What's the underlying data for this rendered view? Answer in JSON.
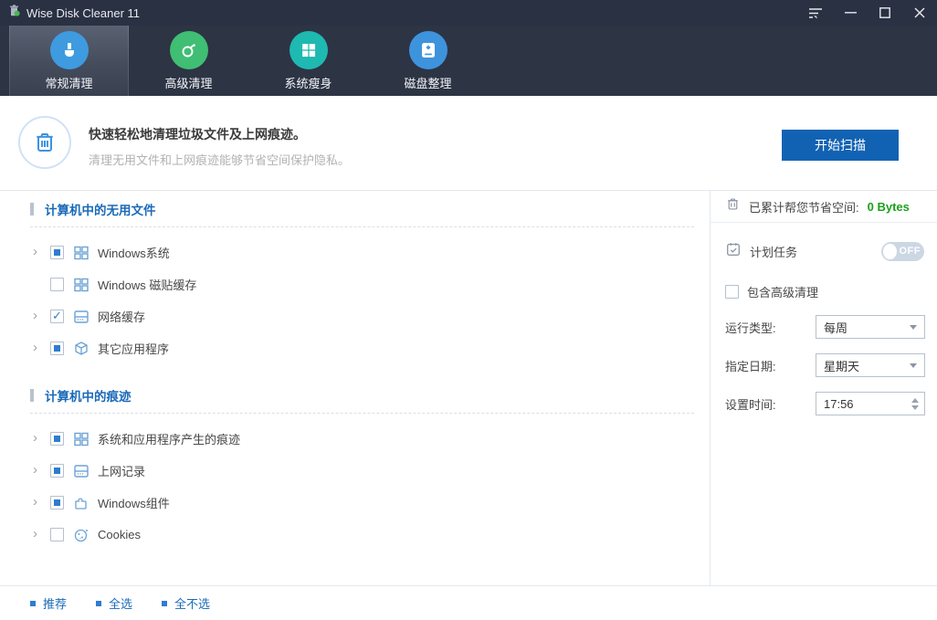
{
  "window": {
    "title": "Wise Disk Cleaner 11",
    "app_icon": "trash-app-icon",
    "controls": [
      {
        "name": "menu-icon"
      },
      {
        "name": "minimize-icon"
      },
      {
        "name": "maximize-icon"
      },
      {
        "name": "close-icon"
      }
    ]
  },
  "nav": {
    "tabs": [
      {
        "label": "常规清理",
        "icon": "broom-icon",
        "color": "#3e9be0",
        "active": true
      },
      {
        "label": "高级清理",
        "icon": "deep-scan-icon",
        "color": "#3fbe74",
        "active": false
      },
      {
        "label": "系统瘦身",
        "icon": "windows-logo-icon",
        "color": "#1eb9b1",
        "active": false
      },
      {
        "label": "磁盘整理",
        "icon": "disk-icon",
        "color": "#3e93dd",
        "active": false
      }
    ]
  },
  "header": {
    "icon": "trash-circle-icon",
    "title": "快速轻松地清理垃圾文件及上网痕迹。",
    "subtitle": "清理无用文件和上网痕迹能够节省空间保护隐私。",
    "scan_button": "开始扫描"
  },
  "tree": {
    "sections": [
      {
        "title": "计算机中的无用文件",
        "items": [
          {
            "label": "Windows系统",
            "checkbox": "partial",
            "chevron": "shown",
            "icon": "windows-tiles-icon"
          },
          {
            "label": "Windows 磁贴缓存",
            "checkbox": "unchecked",
            "chevron": "hidden",
            "icon": "windows-tiles-icon"
          },
          {
            "label": "网络缓存",
            "checkbox": "checked",
            "chevron": "shown",
            "icon": "browser-window-icon"
          },
          {
            "label": "其它应用程序",
            "checkbox": "partial",
            "chevron": "shown",
            "icon": "cube-icon"
          }
        ]
      },
      {
        "title": "计算机中的痕迹",
        "items": [
          {
            "label": "系统和应用程序产生的痕迹",
            "checkbox": "partial",
            "chevron": "shown",
            "icon": "windows-tiles-icon"
          },
          {
            "label": "上网记录",
            "checkbox": "partial",
            "chevron": "shown",
            "icon": "browser-window-icon"
          },
          {
            "label": "Windows组件",
            "checkbox": "partial",
            "chevron": "shown",
            "icon": "puzzle-icon"
          },
          {
            "label": "Cookies",
            "checkbox": "unchecked",
            "chevron": "shown",
            "icon": "cookie-icon"
          }
        ]
      }
    ]
  },
  "sidebar": {
    "saved_icon": "trash-icon",
    "saved_label": "已累计帮您节省空间:",
    "saved_value": "0 Bytes",
    "saved_value_color": "#1ba01b",
    "schedule_icon": "calendar-check-icon",
    "schedule_label": "计划任务",
    "schedule_toggle": "OFF",
    "include_advanced_label": "包含高级清理",
    "include_advanced_checked": "unchecked",
    "run_type_label": "运行类型:",
    "run_type_value": "每周",
    "day_label": "指定日期:",
    "day_value": "星期天",
    "time_label": "设置时间:",
    "time_value": "17:56"
  },
  "footer": {
    "links": [
      "推荐",
      "全选",
      "全不选"
    ]
  },
  "colors": {
    "titlebar_bg": "#2a3142",
    "nav_bg": "#2d3444",
    "accent_blue": "#1262b3",
    "section_blue": "#1a6ab8",
    "link_blue": "#1a6bb8",
    "saved_green": "#1ba01b",
    "checkbox_blue": "#2e7cd0",
    "tree_icon_blue": "#6ba3d6",
    "toggle_off_bg": "#ccd7e4"
  }
}
